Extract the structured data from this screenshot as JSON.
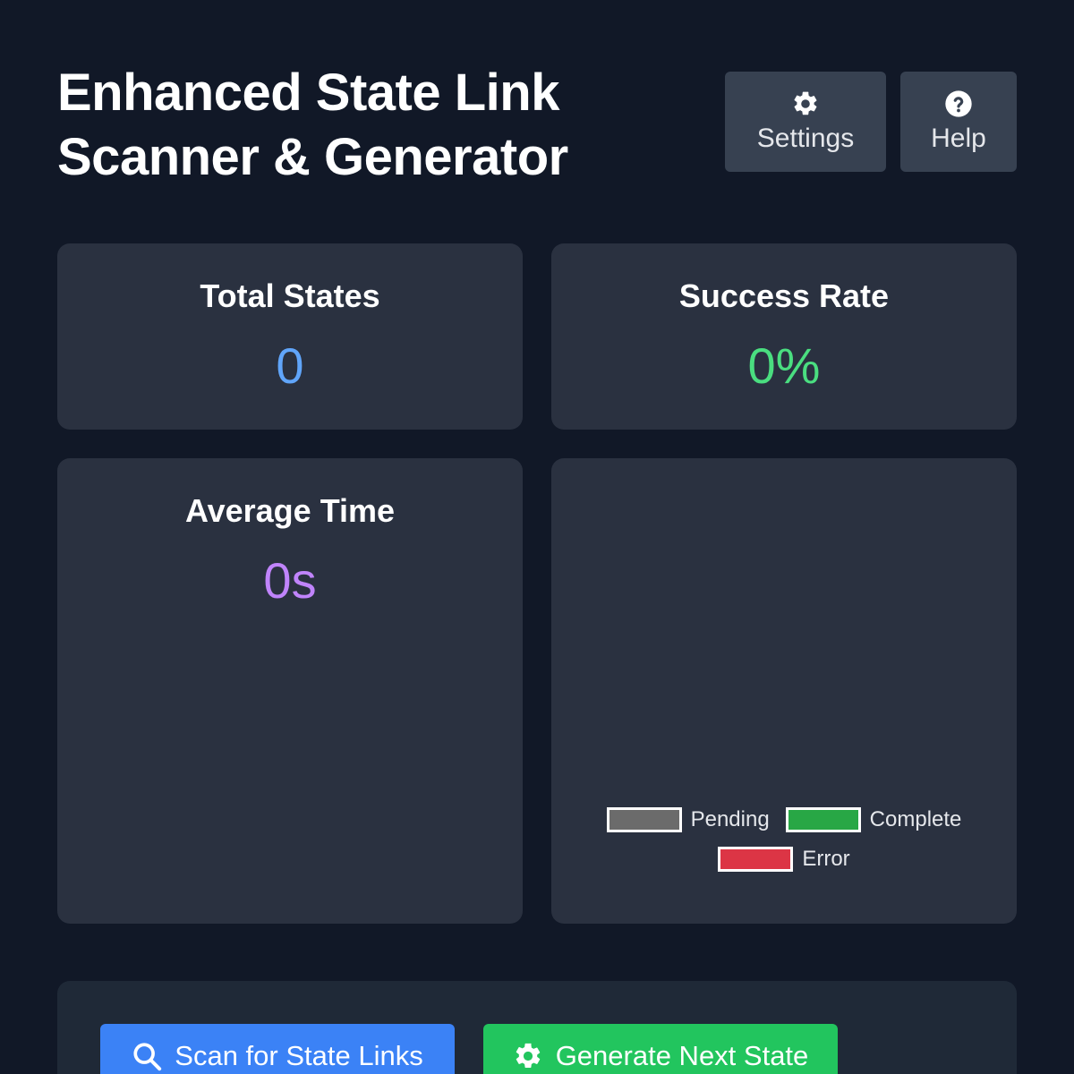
{
  "header": {
    "title": "Enhanced State Link Scanner & Generator",
    "settings_label": "Settings",
    "help_label": "Help"
  },
  "stats": {
    "total_states": {
      "label": "Total States",
      "value": "0",
      "color": "#60a5fa"
    },
    "success_rate": {
      "label": "Success Rate",
      "value": "0%",
      "color": "#4ade80"
    },
    "average_time": {
      "label": "Average Time",
      "value": "0s",
      "color": "#c084fc"
    }
  },
  "legend": [
    {
      "label": "Pending",
      "color": "#6b6b6b"
    },
    {
      "label": "Complete",
      "color": "#28a745"
    },
    {
      "label": "Error",
      "color": "#dc3545"
    }
  ],
  "actions": {
    "scan_label": "Scan for State Links",
    "generate_label": "Generate Next State",
    "scan_color": "#3b82f6",
    "generate_color": "#22c55e"
  },
  "icons": {
    "settings": "gear-icon",
    "help": "question-circle-icon",
    "scan": "search-icon",
    "generate": "gear-icon"
  }
}
